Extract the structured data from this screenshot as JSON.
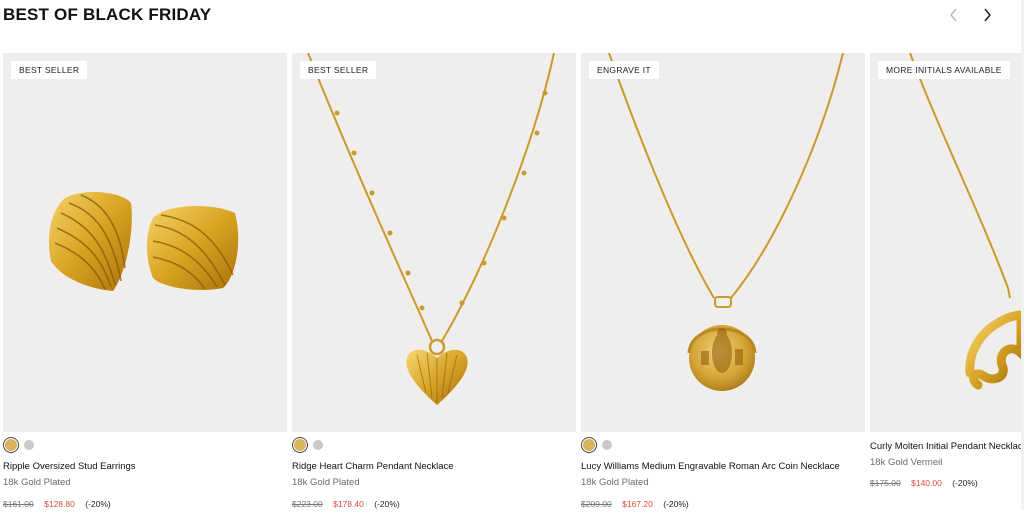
{
  "section": {
    "title": "BEST OF BLACK FRIDAY"
  },
  "nav": {
    "prev_icon": "chevron-left-icon",
    "next_icon": "chevron-right-icon"
  },
  "colors": {
    "sale": "#d94d3a",
    "gold_swatch": "#d9b55a",
    "silver_swatch": "#c9c9c9",
    "image_bg": "#efeeec"
  },
  "products": [
    {
      "badge": "BEST SELLER",
      "name": "Ripple Oversized Stud Earrings",
      "finish": "18k Gold Plated",
      "original_price": "$161.00",
      "sale_price": "$128.80",
      "discount": "(-20%)",
      "swatches": [
        "gold",
        "silver"
      ]
    },
    {
      "badge": "BEST SELLER",
      "name": "Ridge Heart Charm Pendant Necklace",
      "finish": "18k Gold Plated",
      "original_price": "$223.00",
      "sale_price": "$178.40",
      "discount": "(-20%)",
      "swatches": [
        "gold",
        "silver"
      ]
    },
    {
      "badge": "ENGRAVE IT",
      "name": "Lucy Williams Medium Engravable Roman Arc Coin Necklace",
      "finish": "18k Gold Plated",
      "original_price": "$209.00",
      "sale_price": "$167.20",
      "discount": "(-20%)",
      "swatches": [
        "gold",
        "silver"
      ]
    },
    {
      "badge": "MORE INITIALS AVAILABLE",
      "name": "Curly Molten Initial Pendant Necklace",
      "finish": "18k Gold Vermeil",
      "original_price": "$175.00",
      "sale_price": "$140.00",
      "discount": "(-20%)",
      "swatches": []
    }
  ]
}
